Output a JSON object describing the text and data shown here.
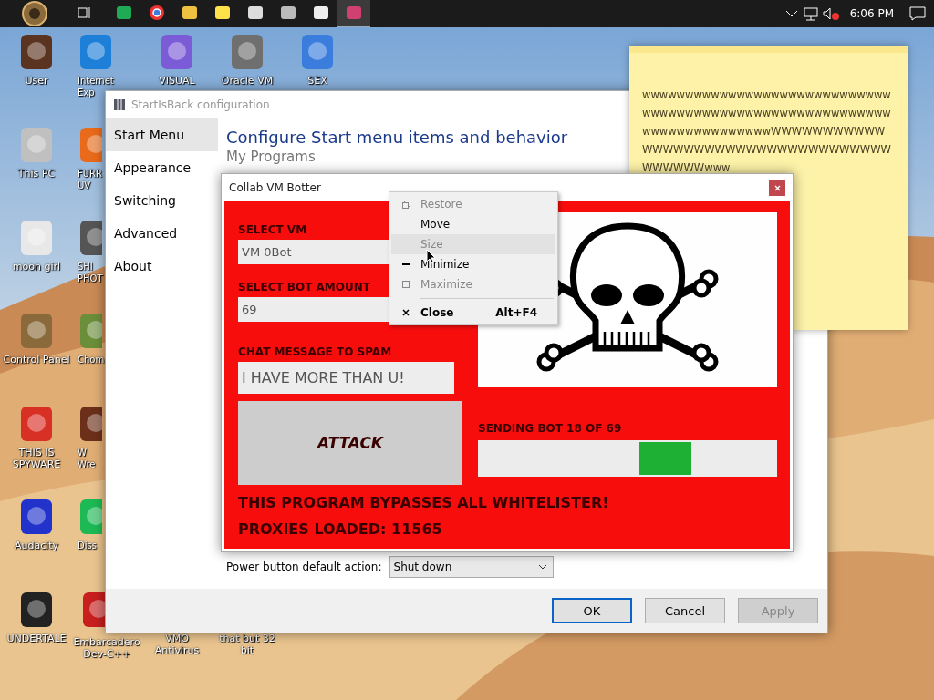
{
  "taskbar": {
    "apps": [
      {
        "active": false
      },
      {
        "active": false
      },
      {
        "active": false
      },
      {
        "active": false
      },
      {
        "active": false
      },
      {
        "active": false
      },
      {
        "active": false
      },
      {
        "active": true
      }
    ],
    "clock": "6:06 PM"
  },
  "desktop_columns": [
    [
      {
        "lines": [
          "User"
        ]
      },
      {
        "lines": [
          "This PC"
        ]
      },
      {
        "lines": [
          "moon girl"
        ]
      },
      {
        "lines": [
          "Control Panel"
        ]
      },
      {
        "lines": [
          "THIS IS",
          "SPYWARE"
        ]
      },
      {
        "lines": [
          "Audacity"
        ]
      },
      {
        "lines": [
          "UNDERTALE"
        ]
      }
    ],
    [
      {
        "lines": [
          "Internet",
          "Exp"
        ]
      },
      {
        "lines": [
          "FURR",
          "UV"
        ]
      },
      {
        "lines": [
          "SHI",
          "PHOT"
        ]
      },
      {
        "lines": [
          "Chom"
        ]
      },
      {
        "lines": [
          "W",
          "Wre"
        ]
      },
      {
        "lines": [
          "Diss"
        ]
      },
      {
        "lines": [
          "Embarcadero",
          "Dev-C++"
        ]
      }
    ],
    [
      {
        "lines": [
          "VISUAL"
        ]
      },
      {
        "lines": [
          "VMO",
          "Antivirus"
        ]
      }
    ],
    [
      {
        "lines": [
          "Oracle VM"
        ]
      },
      {
        "lines": [
          "that but 32",
          "bit"
        ]
      }
    ],
    [
      {
        "lines": [
          "SEX"
        ]
      }
    ]
  ],
  "config_window": {
    "title": "StartIsBack configuration",
    "sidebar": [
      {
        "label": "Start Menu",
        "selected": true
      },
      {
        "label": "Appearance",
        "selected": false
      },
      {
        "label": "Switching",
        "selected": false
      },
      {
        "label": "Advanced",
        "selected": false
      },
      {
        "label": "About",
        "selected": false
      }
    ],
    "heading": "Configure Start menu items and behavior",
    "subheading": "My Programs",
    "power": {
      "label": "Power button default action:",
      "value": "Shut down"
    },
    "buttons": [
      {
        "label": "OK",
        "default": true,
        "disabled": false
      },
      {
        "label": "Cancel",
        "default": false,
        "disabled": false
      },
      {
        "label": "Apply",
        "default": false,
        "disabled": true
      }
    ]
  },
  "sticky_note": {
    "text": "wwwwwwwwwwwwwwwwwwwwwwwwwwwwwwwwwwwwwwwwwwwwwwwwwwwwwwwwwwwwwwwwwwwwwwwwwWWWWWWWWWWWWWWWWWWWWWWWWWWWWWWWWWWWWWWWWWwww"
  },
  "bot_window": {
    "title": "Collab VM Botter",
    "fields": [
      {
        "label": "SELECT VM",
        "value": "VM 0Bot"
      },
      {
        "label": "SELECT BOT AMOUNT",
        "value": "69"
      },
      {
        "label": "CHAT MESSAGE TO SPAM",
        "value": "I HAVE MORE THAN U!"
      }
    ],
    "attack_button": "ATTACK",
    "progress": {
      "label": "SENDING BOT 18 OF 69"
    },
    "notices": [
      "THIS PROGRAM BYPASSES ALL WHITELISTER!",
      "PROXIES LOADED: 11565"
    ]
  },
  "context_menu": [
    {
      "kind": "command",
      "label": "Restore",
      "disabled": true,
      "selected": false
    },
    {
      "kind": "command",
      "label": "Move",
      "disabled": false,
      "selected": false
    },
    {
      "kind": "command",
      "label": "Size",
      "disabled": true,
      "selected": true
    },
    {
      "kind": "command",
      "label": "Minimize",
      "disabled": false,
      "selected": false
    },
    {
      "kind": "command",
      "label": "Maximize",
      "disabled": true,
      "selected": false
    },
    {
      "kind": "separator"
    },
    {
      "kind": "command",
      "label": "Close",
      "disabled": false,
      "selected": false,
      "default": true,
      "shortcut": "Alt+F4"
    }
  ]
}
